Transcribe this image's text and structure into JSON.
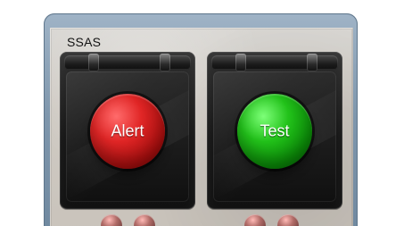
{
  "panel": {
    "title": "SSAS"
  },
  "buttons": [
    {
      "label": "Alert"
    },
    {
      "label": "Test"
    }
  ]
}
